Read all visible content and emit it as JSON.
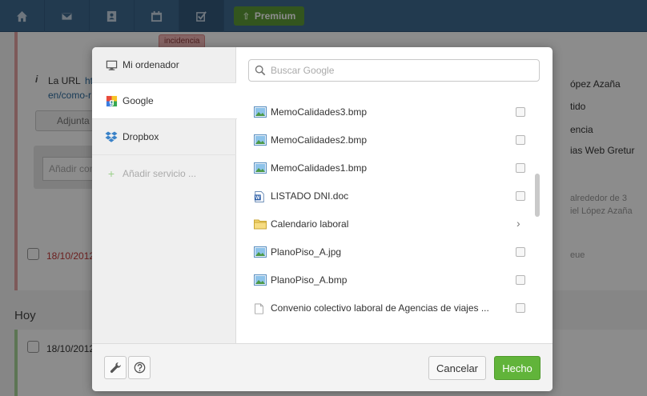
{
  "topbar": {
    "premium_label": "Premium",
    "incidencia_tag": "incidencia"
  },
  "background": {
    "note_text": "La URL",
    "note_link": "ht",
    "note_link2": "en/como-r",
    "attach_label": "Adjunta",
    "comment_placeholder": "Añadir com",
    "right_lines": [
      "ópez Azaña",
      "tido",
      "encia",
      "ias Web Gretur"
    ],
    "right_note": [
      "alrededor de 3",
      "iel López Azaña"
    ],
    "date_red": "18/10/2012",
    "repeat_label": "eue",
    "hoy": "Hoy",
    "date2": "18/10/2012"
  },
  "dialog": {
    "sidebar": {
      "items": [
        {
          "label": "Mi ordenador"
        },
        {
          "label": "Google"
        },
        {
          "label": "Dropbox"
        }
      ],
      "add_service": "Añadir servicio ..."
    },
    "search": {
      "placeholder": "Buscar Google",
      "value": ""
    },
    "files": [
      {
        "name": "MemoCalidades3.bmp",
        "type": "image"
      },
      {
        "name": "MemoCalidades2.bmp",
        "type": "image"
      },
      {
        "name": "MemoCalidades1.bmp",
        "type": "image"
      },
      {
        "name": "LISTADO DNI.doc",
        "type": "word"
      },
      {
        "name": "Calendario laboral",
        "type": "folder"
      },
      {
        "name": "PlanoPiso_A.jpg",
        "type": "image"
      },
      {
        "name": "PlanoPiso_A.bmp",
        "type": "image"
      },
      {
        "name": "Convenio colectivo laboral de Agencias de viajes ...",
        "type": "document"
      }
    ],
    "footer": {
      "cancel_label": "Cancelar",
      "done_label": "Hecho"
    }
  },
  "colors": {
    "topbar": "#3f6a91",
    "premium": "#5d9b38",
    "done_button": "#61b43a"
  }
}
